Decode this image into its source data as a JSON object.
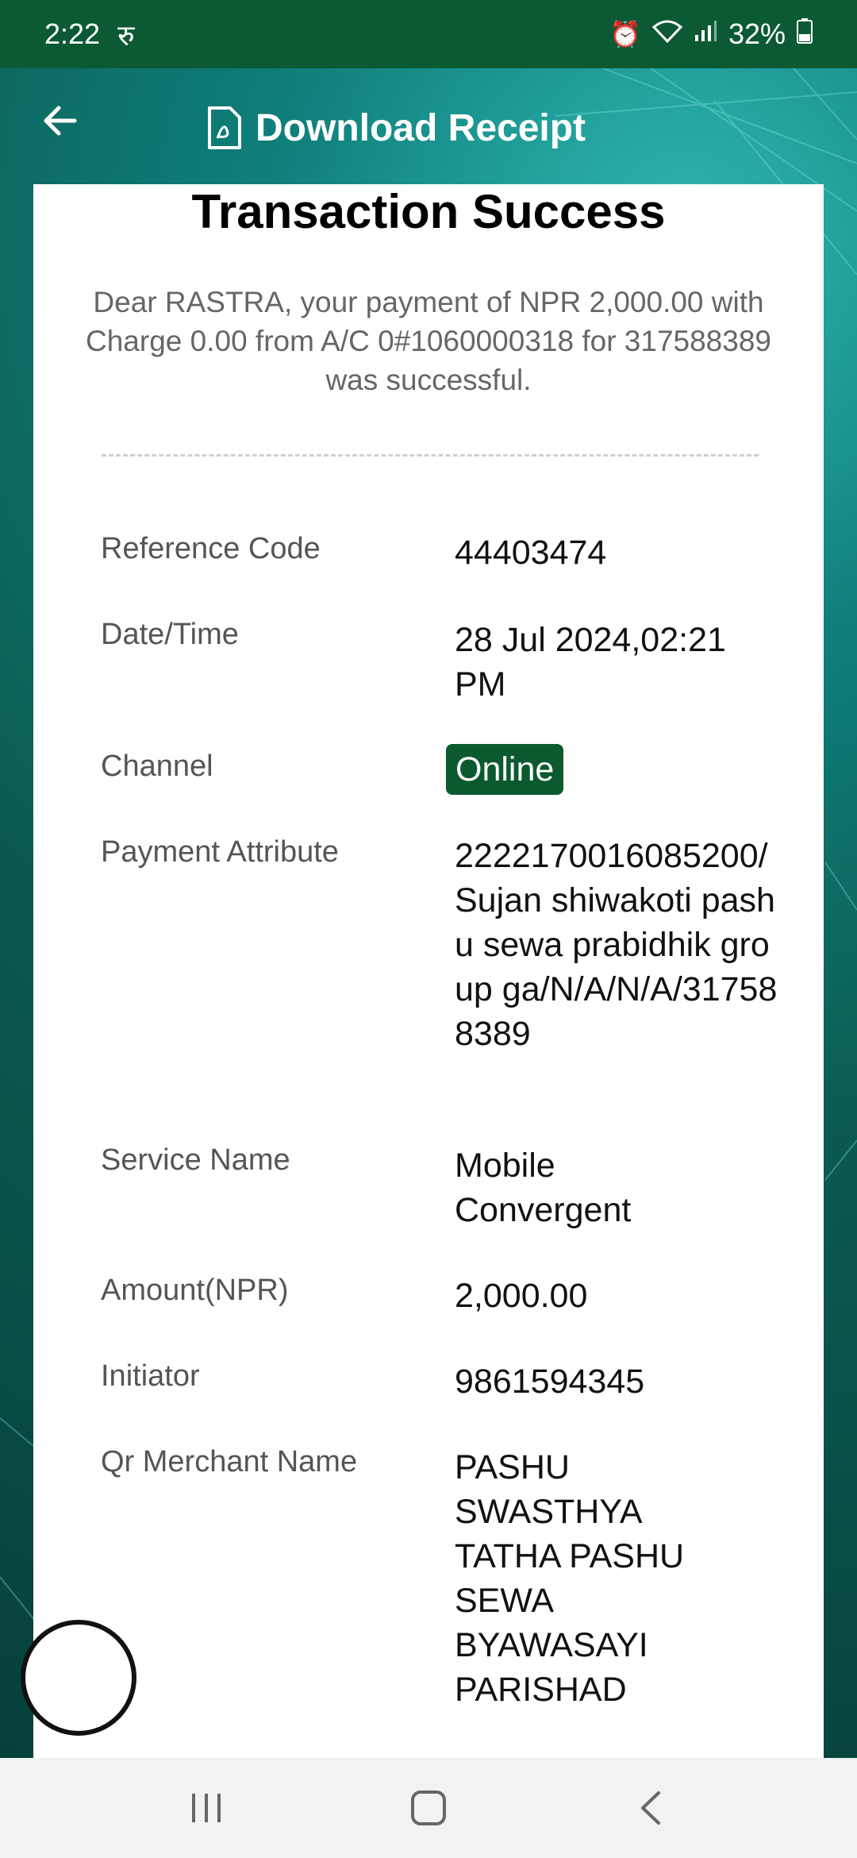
{
  "status_bar": {
    "time": "2:22",
    "indicator": "रु",
    "battery": "32%"
  },
  "header": {
    "title": "Download Receipt"
  },
  "card": {
    "title": "Transaction Success",
    "message": "Dear RASTRA, your payment of NPR 2,000.00 with Charge 0.00 from A/C 0#1060000318 for 317588389 was successful.",
    "rows": [
      {
        "label": "Reference Code",
        "value": "44403474"
      },
      {
        "label": "Date/Time",
        "value": "28 Jul 2024,02:21 PM"
      },
      {
        "label": "Channel",
        "value": "Online"
      },
      {
        "label": "Payment Attribute",
        "value": "2222170016085200/Sujan shiwakoti  pashu sewa prabidhik group ga/N/A/N/A/317588389"
      },
      {
        "label": "Service Name",
        "value": "Mobile Convergent"
      },
      {
        "label": "Amount(NPR)",
        "value": "2,000.00"
      },
      {
        "label": "Initiator",
        "value": "9861594345"
      },
      {
        "label": "Qr Merchant Name",
        "value": "PASHU SWASTHYA TATHA PASHU SEWA BYAWASAYI PARISHAD"
      }
    ]
  },
  "colors": {
    "brand_green": "#0c5a34",
    "badge_green": "#0b5a2f"
  }
}
